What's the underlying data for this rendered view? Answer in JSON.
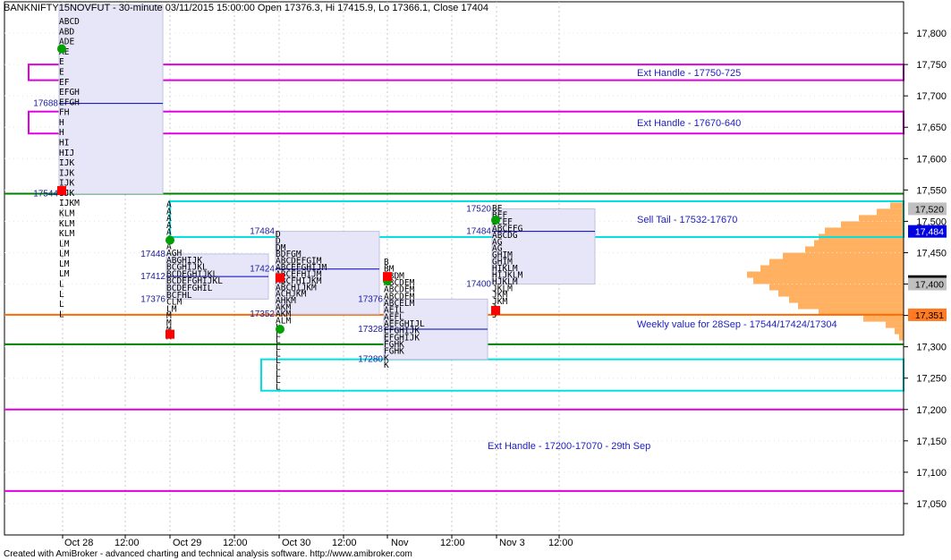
{
  "header": {
    "title": "BANKNIFTY15NOVFUT - 30-minute 03/11/2015 15:00:00 Open 17376.3, Hi 17415.9, Lo 17366.1, Close 17404"
  },
  "footer": {
    "text": "Created with AmiBroker - advanced charting and technical analysis software. http://www.amibroker.com"
  },
  "chart_data": {
    "type": "market-profile",
    "symbol": "BANKNIFTY15NOVFUT",
    "interval": "30-minute",
    "ohlc": {
      "datetime": "03/11/2015 15:00:00",
      "open": 17376.3,
      "high": 17415.9,
      "low": 17366.1,
      "close": 17404
    },
    "ylim": [
      17000,
      17850
    ],
    "y_ticks": [
      {
        "v": 17050,
        "t": "17,050"
      },
      {
        "v": 17100,
        "t": "17,100"
      },
      {
        "v": 17150,
        "t": "17,150"
      },
      {
        "v": 17200,
        "t": "17,200"
      },
      {
        "v": 17250,
        "t": "17,250"
      },
      {
        "v": 17300,
        "t": "17,300"
      },
      {
        "v": 17350,
        "t": "17,350"
      },
      {
        "v": 17400,
        "t": "17,400"
      },
      {
        "v": 17450,
        "t": "17,450"
      },
      {
        "v": 17500,
        "t": "17,500"
      },
      {
        "v": 17550,
        "t": "17,550"
      },
      {
        "v": 17600,
        "t": "17,600"
      },
      {
        "v": 17650,
        "t": "17,650"
      },
      {
        "v": 17700,
        "t": "17,700"
      },
      {
        "v": 17750,
        "t": "17,750"
      },
      {
        "v": 17800,
        "t": "17,800"
      }
    ],
    "x_ticks": [
      "Oct 28",
      "12:00",
      "Oct 29",
      "12:00",
      "Oct 30",
      "12:00",
      "Nov",
      "12:00",
      "Nov 3",
      "12:00"
    ],
    "price_tags": [
      {
        "v": 17520,
        "t": "17,520",
        "style": "gray"
      },
      {
        "v": 17484,
        "t": "17,484",
        "style": "blue"
      },
      {
        "v": 17404,
        "t": "17,404",
        "style": "black"
      },
      {
        "v": 17400,
        "t": "17,400",
        "style": "gray"
      },
      {
        "v": 17351,
        "t": "17,351",
        "style": "orange"
      }
    ],
    "zones": [
      {
        "label": "Ext Handle - 17750-725",
        "top": 17750,
        "bottom": 17725,
        "color": "#e000e0"
      },
      {
        "label": "Ext Handle - 17670-640",
        "top": 17675,
        "bottom": 17640,
        "color": "#e000e0"
      },
      {
        "label": "Sell Tail - 17532-17670",
        "top": 17532,
        "bottom": 17475,
        "color": "#00e0e0"
      },
      {
        "label": "",
        "top": 17280,
        "bottom": 17230,
        "color": "#00e0e0"
      }
    ],
    "lines": [
      {
        "v": 17544,
        "color": "#008000",
        "label": ""
      },
      {
        "v": 17304,
        "color": "#008000",
        "label": ""
      },
      {
        "v": 17351,
        "color": "#ff6a00",
        "label": "Weekly value for 28Sep - 17544/17424/17304"
      },
      {
        "v": 17200,
        "color": "#e000e0",
        "label": "Ext Handle - 17200-17070 - 29th Sep"
      },
      {
        "v": 17070,
        "color": "#e000e0",
        "label": ""
      }
    ],
    "sessions": [
      {
        "date": "Oct 28",
        "high": 17828,
        "low": 17345,
        "poc": 17688,
        "vah": 17845,
        "val": 17544,
        "levels": [
          {
            "t": "17688",
            "v": 17688
          },
          {
            "t": "17544",
            "v": 17544
          }
        ],
        "rows": [
          "ABCD",
          "ABD",
          "ADE",
          "AE",
          "E",
          "E",
          "EF",
          "EFGH",
          "EFGH",
          "FH",
          "H",
          "H",
          "HI",
          "HIJ",
          "IJK",
          "IJK",
          "IJK",
          "IJK",
          "IJKM",
          "KLM",
          "KLM",
          "KLM",
          "LM",
          "LM",
          "LM",
          "LM",
          "L",
          "L",
          "L",
          "L"
        ]
      },
      {
        "date": "Oct 29",
        "high": 17532,
        "low": 17310,
        "poc": 17412,
        "vah": 17448,
        "val": 17376,
        "levels": [
          {
            "t": "17448",
            "v": 17448
          },
          {
            "t": "17412",
            "v": 17412
          },
          {
            "t": "17376",
            "v": 17376
          }
        ],
        "rows": [
          "A",
          "A",
          "A",
          "A",
          "A",
          "A",
          "A",
          "AGH",
          "ABGHIJK",
          "BCGHIJKL",
          "BCDEGHIJKL",
          "BCDEFGHIJKL",
          "BCDEFGHIL",
          "BCFHL",
          "CLM",
          "LM",
          "M",
          "M",
          "M",
          "M"
        ]
      },
      {
        "date": "Oct 30",
        "high": 17484,
        "low": 17230,
        "poc": 17424,
        "vah": 17484,
        "val": 17352,
        "levels": [
          {
            "t": "17484",
            "v": 17484
          },
          {
            "t": "17424",
            "v": 17424
          },
          {
            "t": "17352",
            "v": 17352
          }
        ],
        "rows": [
          "D",
          "D",
          "DM",
          "BDFGM",
          "ABCDEFGIM",
          "ABCEFGHIJM",
          "ABCEFHIJM",
          "ABCFHIJKM",
          "ABCHIJKM",
          "ACHJKM",
          "AHKM",
          "AKM",
          "AKM",
          "ALM",
          "L",
          "L",
          "L",
          "L",
          "L",
          "L",
          "L",
          "L",
          "L",
          "L"
        ]
      },
      {
        "date": "Nov",
        "high": 17440,
        "low": 17265,
        "poc": 17328,
        "vah": 17376,
        "val": 17280,
        "levels": [
          {
            "t": "17376",
            "v": 17376
          },
          {
            "t": "17328",
            "v": 17328
          },
          {
            "t": "17280",
            "v": 17280
          }
        ],
        "rows": [
          "B",
          "BM",
          "ABDM",
          "ABCDEM",
          "ABCDEM",
          "ABCDEM",
          "ABCELM",
          "AEIL",
          "AEFL",
          "AEFGHIJL",
          "EFGHIJK",
          "EFGHIJK",
          "FGHK",
          "FGHK",
          "K",
          "K"
        ]
      },
      {
        "date": "Nov 3",
        "high": 17525,
        "low": 17345,
        "poc": 17484,
        "vah": 17520,
        "val": 17400,
        "levels": [
          {
            "t": "17520",
            "v": 17520
          },
          {
            "t": "17484",
            "v": 17484
          },
          {
            "t": "17400",
            "v": 17400
          }
        ],
        "rows": [
          "BE",
          "BEF",
          "BCEF",
          "ABCEFG",
          "ABCDG",
          "AG",
          "AG",
          "GHIM",
          "GHIM",
          "HIKLM",
          "HIJKLM",
          "HJKLM",
          "JKLM",
          "JKM",
          "JKM",
          "J",
          "J"
        ]
      }
    ],
    "volume_profile": [
      {
        "v": 17525,
        "w": 15
      },
      {
        "v": 17515,
        "w": 30
      },
      {
        "v": 17505,
        "w": 50
      },
      {
        "v": 17495,
        "w": 70
      },
      {
        "v": 17485,
        "w": 88
      },
      {
        "v": 17475,
        "w": 95
      },
      {
        "v": 17465,
        "w": 100
      },
      {
        "v": 17455,
        "w": 110
      },
      {
        "v": 17445,
        "w": 135
      },
      {
        "v": 17435,
        "w": 150
      },
      {
        "v": 17425,
        "w": 160
      },
      {
        "v": 17415,
        "w": 175
      },
      {
        "v": 17405,
        "w": 168
      },
      {
        "v": 17395,
        "w": 150
      },
      {
        "v": 17385,
        "w": 140
      },
      {
        "v": 17375,
        "w": 128
      },
      {
        "v": 17365,
        "w": 118
      },
      {
        "v": 17355,
        "w": 95
      },
      {
        "v": 17345,
        "w": 45
      },
      {
        "v": 17335,
        "w": 20
      },
      {
        "v": 17325,
        "w": 10
      },
      {
        "v": 17315,
        "w": 5
      }
    ],
    "colors": {
      "value_area": "#e6e6f8",
      "poc_line": "#0000c0",
      "profile": "#ffb060",
      "open_dot": "#00a000",
      "close_square": "#ff0000"
    }
  }
}
